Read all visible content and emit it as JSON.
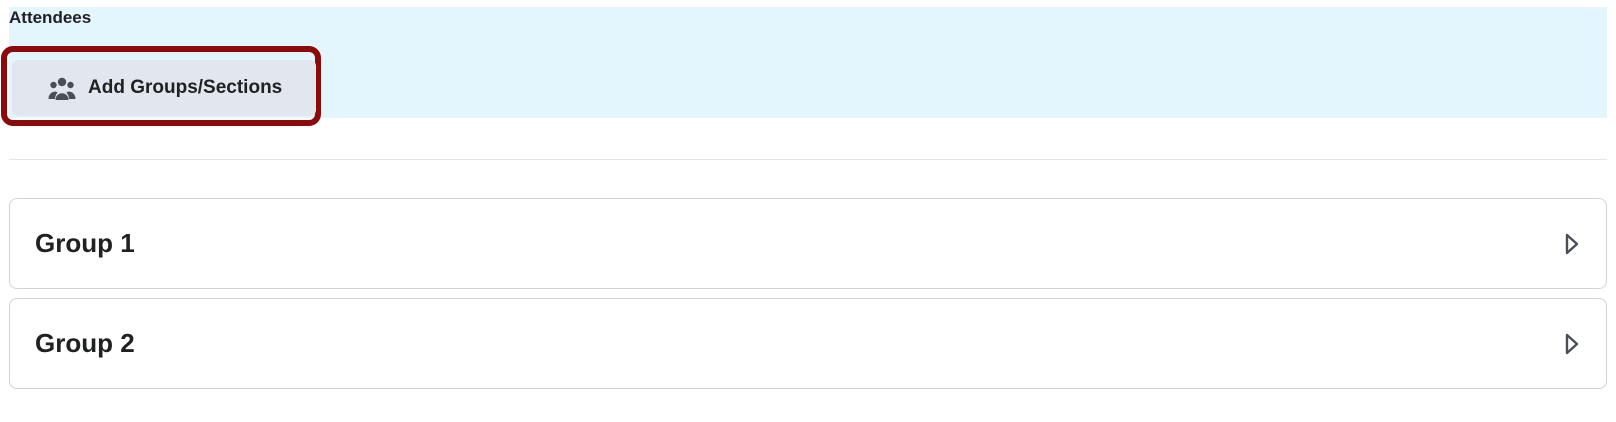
{
  "attendees": {
    "title": "Attendees",
    "add_button_label": "Add Groups/Sections",
    "add_button_icon": "group-icon"
  },
  "groups": [
    {
      "label": "Group 1",
      "icon": "chevron-right-icon"
    },
    {
      "label": "Group 2",
      "icon": "chevron-right-icon"
    }
  ],
  "colors": {
    "panel_background": "#e3f5fd",
    "button_background": "#e2e7ef",
    "highlight": "#8b0a0a",
    "text": "#202122",
    "card_border": "#cfd3d8"
  }
}
